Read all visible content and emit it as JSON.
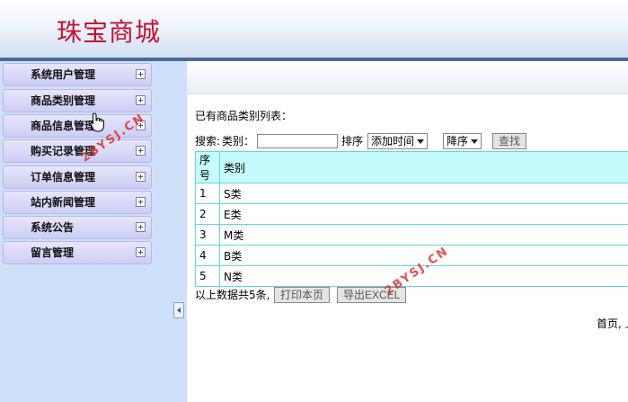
{
  "header": {
    "title": "珠宝商城"
  },
  "sidebar": {
    "items": [
      {
        "label": "系统用户管理"
      },
      {
        "label": "商品类别管理"
      },
      {
        "label": "商品信息管理"
      },
      {
        "label": "购买记录管理"
      },
      {
        "label": "订单信息管理"
      },
      {
        "label": "站内新闻管理"
      },
      {
        "label": "系统公告"
      },
      {
        "label": "留言管理"
      }
    ]
  },
  "main": {
    "list_title": "已有商品类别列表：",
    "search": {
      "label": "搜索:",
      "category_label": "类别：",
      "category_value": "",
      "sort_label": "排序",
      "sort_field": "添加时间",
      "sort_order": "降序",
      "search_button": "查找"
    },
    "table": {
      "headers": [
        "序号",
        "类别"
      ],
      "rows": [
        [
          "1",
          "S类"
        ],
        [
          "2",
          "E类"
        ],
        [
          "3",
          "M类"
        ],
        [
          "4",
          "B类"
        ],
        [
          "5",
          "N类"
        ]
      ]
    },
    "footer": {
      "summary": "以上数据共5条,",
      "print_button": "打印本页",
      "export_button": "导出EXCEL"
    },
    "paging": "首页, 上"
  },
  "watermark": "2BYSJ.CN",
  "colors": {
    "title": "#c8102e",
    "table_border": "#5fd7e6",
    "table_header": "#c6fbfd",
    "sidebar_bg": "#cfe0fa"
  },
  "icons": [
    "plus-icon",
    "collapse-arrow-icon",
    "hand-cursor-icon"
  ]
}
